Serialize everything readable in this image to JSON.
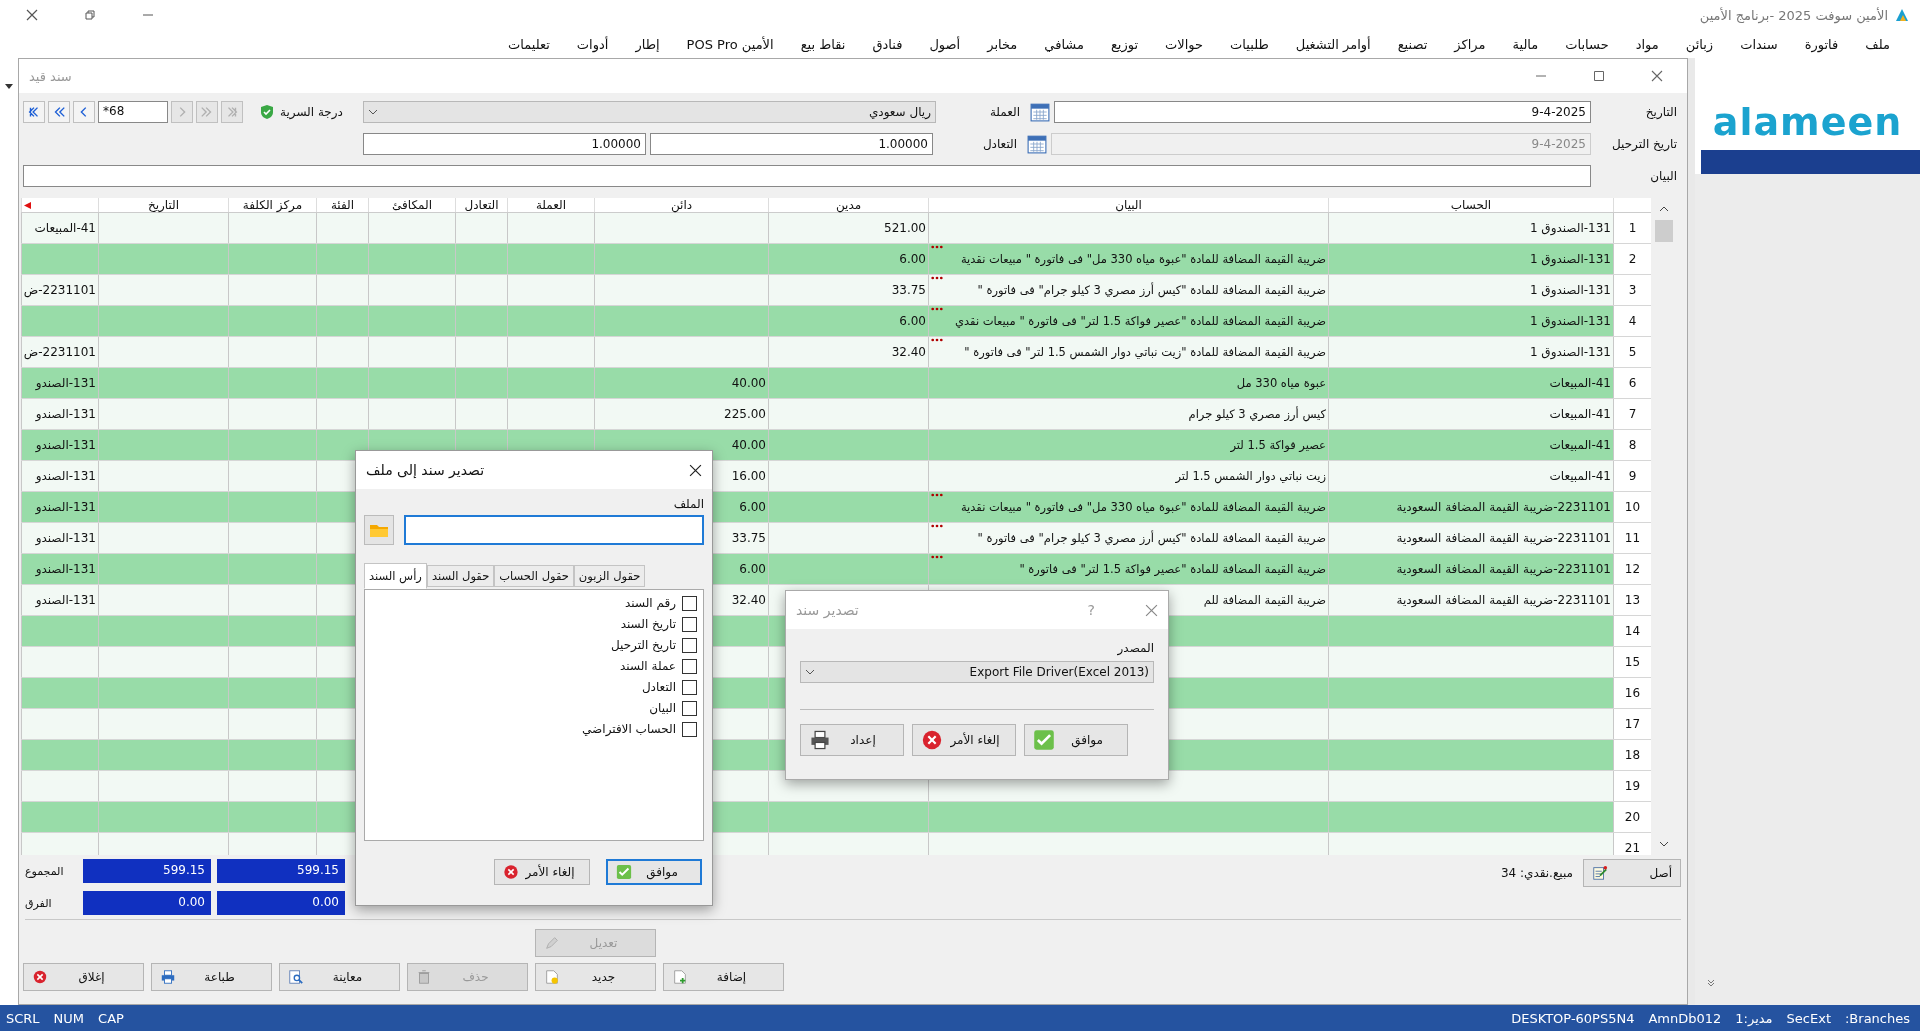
{
  "app_title": "الأمين سوفت 2025 -برنامج الأمين",
  "menu": [
    "ملف",
    "فاتورة",
    "سندات",
    "زبائن",
    "مواد",
    "حسابات",
    "مالية",
    "مراكز",
    "تصنيع",
    "أوامر التشغيل",
    "طلبيات",
    "حوالات",
    "توزيع",
    "مشافي",
    "مخابر",
    "أصول",
    "فنادق",
    "نقاط بيع",
    "الأمين POS Pro",
    "إطار",
    "أدوات",
    "تعليمات"
  ],
  "document_window": {
    "title": "سند قيد",
    "nav_buttons": [
      {
        "kind": "first",
        "disabled": false
      },
      {
        "kind": "fast_prev",
        "disabled": false
      },
      {
        "kind": "prev",
        "disabled": false
      },
      {
        "kind": "next",
        "disabled": true
      },
      {
        "kind": "fast_next",
        "disabled": true
      },
      {
        "kind": "last",
        "disabled": true
      }
    ],
    "number": "*68",
    "secrecy_label": "درجة السرية",
    "date_label": "التاريخ",
    "date": "9-4-2025",
    "currency_label": "العملة",
    "currency": "ريال سعودي",
    "posting_date_label": "تاريخ الترحيل",
    "posting_date": "9-4-2025",
    "posting_date_disabled": true,
    "rate_label": "التعادل",
    "rate": "1.00000",
    "rate_2": "1.00000",
    "description_label": "البيان",
    "table": {
      "columns": [
        "الحساب",
        "البيان",
        "مدين",
        "دائن",
        "العملة",
        "التعادل",
        "المكافئ",
        "الفئة",
        "مركز الكلفة",
        "التاريخ"
      ],
      "rows": [
        {
          "num": "1",
          "account": "131-الصندوق 1",
          "debit": "521.00",
          "column_12": "41-المبيعات",
          "truncated": false
        },
        {
          "num": "2",
          "account": "131-الصندوق 1",
          "description": "ضريبة القيمة المضافة  للمادة \"عبوة مياه 330 مل\" فى فاتورة \" مبيعات نقدية",
          "debit": "6.00",
          "truncated": true
        },
        {
          "num": "3",
          "account": "131-الصندوق 1",
          "description": "ضريبة القيمة المضافة  للمادة \"كيس أرز مصري 3 كيلو جرام\" فى فاتورة \"",
          "debit": "33.75",
          "column_12": "2231101-ض",
          "truncated": true
        },
        {
          "num": "4",
          "account": "131-الصندوق 1",
          "description": "ضريبة القيمة المضافة  للمادة \"عصير فواكة 1.5 لتر\" فى فاتورة \" مبيعات نقدي",
          "debit": "6.00",
          "truncated": true
        },
        {
          "num": "5",
          "account": "131-الصندوق 1",
          "description": "ضريبة القيمة المضافة  للمادة \"زيت نباتي دوار الشمس 1.5 لتر\" فى فاتورة \"",
          "debit": "32.40",
          "column_12": "2231101-ض",
          "truncated": true
        },
        {
          "num": "6",
          "account": "41-المبيعات",
          "description": "عبوة مياه 330 مل",
          "credit": "40.00",
          "column_12": "131-الصندو",
          "truncated": false
        },
        {
          "num": "7",
          "account": "41-المبيعات",
          "description": "كيس أرز مصري 3 كيلو جرام",
          "credit": "225.00",
          "column_12": "131-الصندو",
          "truncated": false
        },
        {
          "num": "8",
          "account": "41-المبيعات",
          "description": "عصير فواكة 1.5 لتر",
          "credit": "40.00",
          "column_12": "131-الصندو",
          "truncated": false
        },
        {
          "num": "9",
          "account": "41-المبيعات",
          "description": "زيت نباتي دوار الشمس 1.5 لتر",
          "credit": "16.00",
          "column_12": "131-الصندو",
          "truncated": false
        },
        {
          "num": "10",
          "account": "2231101-ضريبة القيمة المضافة السعودية",
          "description": "ضريبة القيمة المضافة  للمادة \"عبوة مياه 330 مل\" فى فاتورة \" مبيعات نقدية",
          "credit": "6.00",
          "column_12": "131-الصندو",
          "truncated": true
        },
        {
          "num": "11",
          "account": "2231101-ضريبة القيمة المضافة السعودية",
          "description": "ضريبة القيمة المضافة  للمادة \"كيس أرز مصري 3 كيلو جرام\" فى فاتورة \"",
          "credit": "33.75",
          "column_12": "131-الصندو",
          "truncated": true
        },
        {
          "num": "12",
          "account": "2231101-ضريبة القيمة المضافة السعودية",
          "description": "ضريبة القيمة المضافة  للمادة \"عصير فواكة 1.5 لتر\" فى فاتورة \"",
          "credit": "6.00",
          "column_12": "131-الصندو",
          "truncated": true
        },
        {
          "num": "13",
          "account": "2231101-ضريبة القيمة المضافة السعودية",
          "description": "ضريبة القيمة المضافة  للم",
          "credit": "32.40",
          "column_12": "131-الصندو",
          "truncated": false
        },
        {
          "num": "14",
          "truncated": false
        },
        {
          "num": "15",
          "truncated": false
        },
        {
          "num": "16",
          "truncated": false
        },
        {
          "num": "17",
          "truncated": false
        },
        {
          "num": "18",
          "truncated": false
        },
        {
          "num": "19",
          "truncated": false
        },
        {
          "num": "20",
          "truncated": false
        },
        {
          "num": "21",
          "truncated": false
        }
      ]
    },
    "totals": {
      "sum_label": "المجموع",
      "sum_values": [
        "599.15",
        "599.15"
      ],
      "diff_label": "الفرق",
      "diff_values": [
        "0.00",
        "0.00"
      ]
    },
    "origin_button": "أصل",
    "invoice_note": "مبيع.نقدي: 34",
    "edit_button": {
      "label": "تعديل",
      "disabled": true
    },
    "buttons": [
      {
        "kind": "add",
        "label": "إضافة",
        "disabled": false
      },
      {
        "kind": "new",
        "label": "جديد",
        "disabled": false
      },
      {
        "kind": "delete",
        "label": "حذف",
        "disabled": true
      },
      {
        "kind": "preview",
        "label": "معاينة",
        "disabled": false
      },
      {
        "kind": "print",
        "label": "طباعة",
        "disabled": false
      },
      {
        "kind": "close",
        "label": "إغلاق",
        "disabled": false
      }
    ]
  },
  "logo": "alameen",
  "export_file_dialog": {
    "title": "تصدير سند إلى ملف",
    "file_label": "الملف",
    "file_field_focused": true,
    "tabs": [
      {
        "label": "حقول الزبون",
        "selected": false
      },
      {
        "label": "حقول الحساب",
        "selected": false
      },
      {
        "label": "حقول السند",
        "selected": false
      },
      {
        "label": "رأس السند",
        "selected": true
      }
    ],
    "fields": [
      {
        "label": "رقم السند",
        "checked": false
      },
      {
        "label": "تاريخ السند",
        "checked": false
      },
      {
        "label": "تاريخ الترحيل",
        "checked": false
      },
      {
        "label": "عملة السند",
        "checked": false
      },
      {
        "label": "التعادل",
        "checked": false
      },
      {
        "label": "البيان",
        "checked": false
      },
      {
        "label": "الحساب الافتراضي",
        "checked": false
      }
    ],
    "buttons": [
      {
        "kind": "ok",
        "label": "موافق",
        "focused": true
      },
      {
        "kind": "cancel",
        "label": "إلغاء الأمر",
        "focused": false
      }
    ]
  },
  "export_dialog": {
    "title": "تصدير سند",
    "help": "?",
    "source_label": "المصدر",
    "source": "Export File Driver(Excel 2013)",
    "buttons": [
      {
        "kind": "ok",
        "label": "موافق"
      },
      {
        "kind": "cancel",
        "label": "إلغاء الأمر"
      },
      {
        "kind": "setup",
        "label": "إعداد"
      }
    ]
  },
  "status_left": [
    "CAP",
    "NUM",
    "SCRL"
  ],
  "status_right": [
    ":Branches",
    "SecExt",
    "1:مدير",
    "AmnDb012",
    "DESKTOP-60PS5N4"
  ]
}
